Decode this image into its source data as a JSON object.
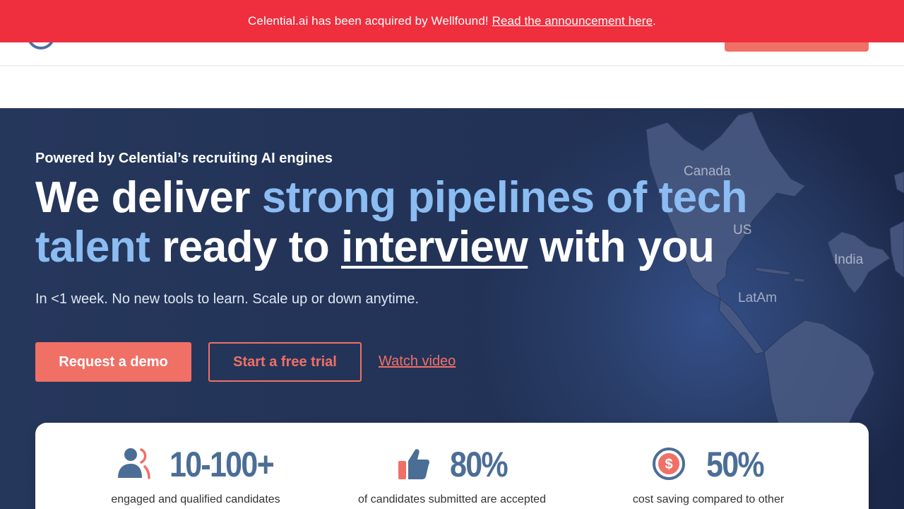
{
  "banner": {
    "text": "Celential.ai has been acquired by Wellfound!",
    "link": "Read the announcement here",
    "suffix": "."
  },
  "hero": {
    "eyebrow": "Powered by Celential’s recruiting AI engines",
    "headline": {
      "part1": "We deliver ",
      "accent": "strong pipelines of tech talent",
      "part2": " ready to ",
      "underlined": "interview",
      "part3": " with you"
    },
    "subline": "In <1 week. No new tools to learn. Scale up or down anytime.",
    "buttons": {
      "demo": "Request a demo",
      "trial": "Start a free trial",
      "video": "Watch video"
    },
    "map_labels": {
      "canada": "Canada",
      "us": "US",
      "india": "India",
      "latam": "LatAm"
    }
  },
  "stats": [
    {
      "icon": "users-icon",
      "value": "10-100+",
      "description": "engaged and qualified candidates"
    },
    {
      "icon": "thumbs-up-icon",
      "value": "80%",
      "description": "of candidates submitted are accepted"
    },
    {
      "icon": "dollar-icon",
      "value": "50%",
      "description": "cost saving compared to other"
    }
  ],
  "colors": {
    "banner": "#ef2e3e",
    "hero_bg": "#243558",
    "accent_blue": "#8bbcf2",
    "coral": "#f07066",
    "stat_blue": "#4b6e96"
  }
}
